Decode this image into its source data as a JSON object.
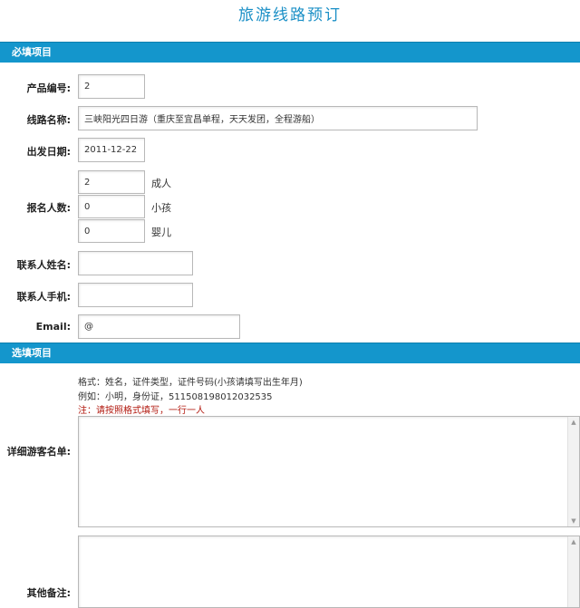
{
  "page": {
    "title": "旅游线路预订"
  },
  "required": {
    "heading": "必填项目",
    "product_no": {
      "label": "产品编号:",
      "value": "2"
    },
    "route_name": {
      "label": "线路名称:",
      "value": "三峡阳光四日游（重庆至宜昌单程，天天发团，全程游船）"
    },
    "departure_date": {
      "label": "出发日期:",
      "value": "2011-12-22"
    },
    "participants": {
      "label": "报名人数:",
      "adults": {
        "value": "2",
        "unit": "成人"
      },
      "children": {
        "value": "0",
        "unit": "小孩"
      },
      "infants": {
        "value": "0",
        "unit": "婴儿"
      }
    },
    "contact_name": {
      "label": "联系人姓名:",
      "value": ""
    },
    "contact_phone": {
      "label": "联系人手机:",
      "value": ""
    },
    "email": {
      "label": "Email:",
      "value": "@"
    }
  },
  "optional": {
    "heading": "选填项目",
    "tourist_list": {
      "label": "详细游客名单:",
      "hint_format": "格式：姓名，证件类型，证件号码(小孩请填写出生年月)",
      "hint_example": "例如：小明，身份证，511508198012032535",
      "hint_note": "注：请按照格式填写，一行一人",
      "value": ""
    },
    "remarks": {
      "label": "其他备注:",
      "value": ""
    }
  },
  "scrollbar": {
    "up_icon": "▲",
    "down_icon": "▼"
  }
}
